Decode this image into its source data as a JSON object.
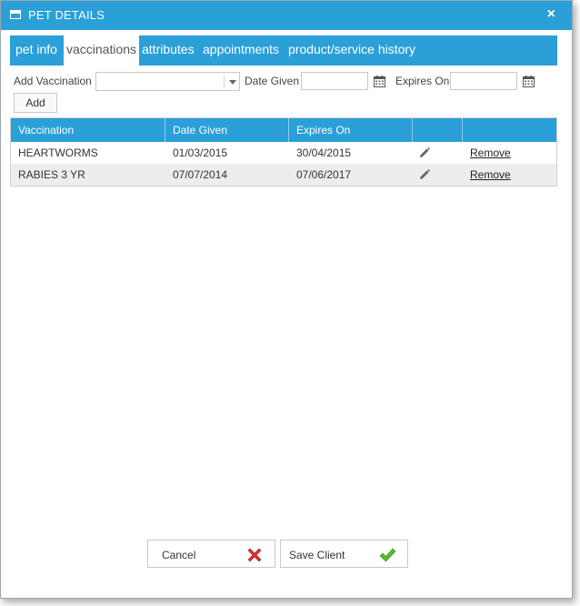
{
  "window": {
    "title": "PET DETAILS",
    "close_glyph": "×"
  },
  "tabs": [
    {
      "label": "pet info",
      "active": false
    },
    {
      "label": "vaccinations",
      "active": true
    },
    {
      "label": "attributes",
      "active": false
    },
    {
      "label": "appointments",
      "active": false
    },
    {
      "label": "product/service history",
      "active": false
    }
  ],
  "form": {
    "add_vaccination_label": "Add Vaccination",
    "vaccination_value": "",
    "date_given_label": "Date Given",
    "date_given_value": "",
    "expires_on_label": "Expires On",
    "expires_on_value": "",
    "add_button": "Add"
  },
  "grid": {
    "columns": [
      "Vaccination",
      "Date Given",
      "Expires On",
      "",
      ""
    ],
    "rows": [
      {
        "vaccination": "HEARTWORMS",
        "date_given": "01/03/2015",
        "expires_on": "30/04/2015",
        "action": "Remove"
      },
      {
        "vaccination": "RABIES 3 YR",
        "date_given": "07/07/2014",
        "expires_on": "07/06/2017",
        "action": "Remove"
      }
    ]
  },
  "footer": {
    "cancel_label": "Cancel",
    "save_label": "Save Client"
  },
  "icons": {
    "window": "window-icon",
    "calendar": "calendar-icon",
    "edit": "pencil-icon",
    "cancel": "red-x-icon",
    "save": "green-check-icon"
  },
  "colors": {
    "accent": "#2a9fd8",
    "row_alt": "#ededed",
    "cancel_icon": "#e0322d",
    "save_icon": "#5cb82e"
  }
}
